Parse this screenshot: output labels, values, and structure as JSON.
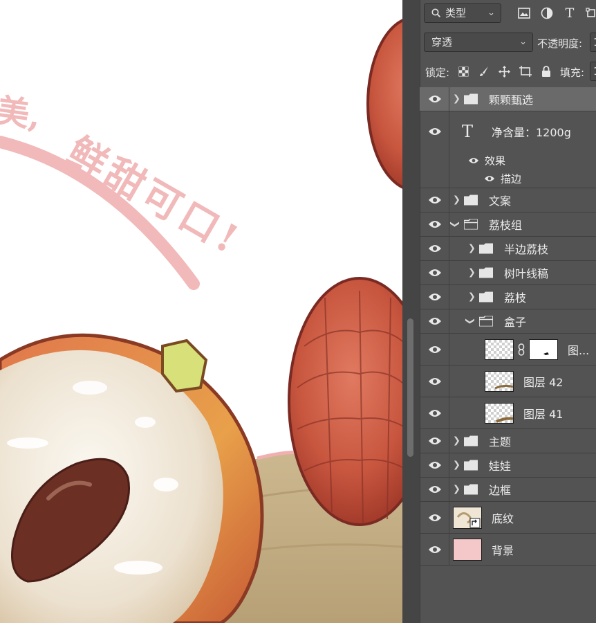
{
  "toolbar": {
    "filter_dropdown": "类型",
    "blend_mode": "穿透",
    "opacity_label": "不透明度:",
    "opacity_value": "1",
    "lock_label": "锁定:",
    "fill_label": "填充:",
    "fill_value": "1"
  },
  "layers": [
    {
      "name": "颗颗甄选",
      "kind": "group",
      "indent": 0,
      "expanded": false,
      "selected": true
    },
    {
      "name": "净含量：1200g",
      "kind": "text",
      "indent": 0
    },
    {
      "name": "效果",
      "kind": "effect-header",
      "indent": 0
    },
    {
      "name": "描边",
      "kind": "effect",
      "indent": 0
    },
    {
      "name": "文案",
      "kind": "group",
      "indent": 0,
      "expanded": false
    },
    {
      "name": "荔枝组",
      "kind": "group",
      "indent": 0,
      "expanded": true
    },
    {
      "name": "半边荔枝",
      "kind": "group",
      "indent": 1,
      "expanded": false
    },
    {
      "name": "树叶线稿",
      "kind": "group",
      "indent": 1,
      "expanded": false
    },
    {
      "name": "荔枝",
      "kind": "group",
      "indent": 1,
      "expanded": false
    },
    {
      "name": "盒子",
      "kind": "group",
      "indent": 1,
      "expanded": true
    },
    {
      "name": "图...",
      "kind": "masked-layer",
      "indent": 2
    },
    {
      "name": "图层 42",
      "kind": "layer",
      "indent": 2
    },
    {
      "name": "图层 41",
      "kind": "layer",
      "indent": 2
    },
    {
      "name": "主题",
      "kind": "group",
      "indent": 0,
      "expanded": false
    },
    {
      "name": "娃娃",
      "kind": "group",
      "indent": 0,
      "expanded": false
    },
    {
      "name": "边框",
      "kind": "group",
      "indent": 0,
      "expanded": false
    },
    {
      "name": "底纹",
      "kind": "smart-object",
      "indent": 0
    },
    {
      "name": "背景",
      "kind": "fill-layer",
      "indent": 0,
      "color": "#f4c8c8"
    }
  ],
  "canvas": {
    "slogan_part1": "美,",
    "slogan_part2": "鲜甜可口!"
  },
  "colors": {
    "panel_bg": "#535353",
    "selected_row": "#6a6a6a",
    "slogan_pink": "#f1b9b9",
    "lychee_red": "#c85a4a",
    "box_tan": "#c9b48c"
  }
}
